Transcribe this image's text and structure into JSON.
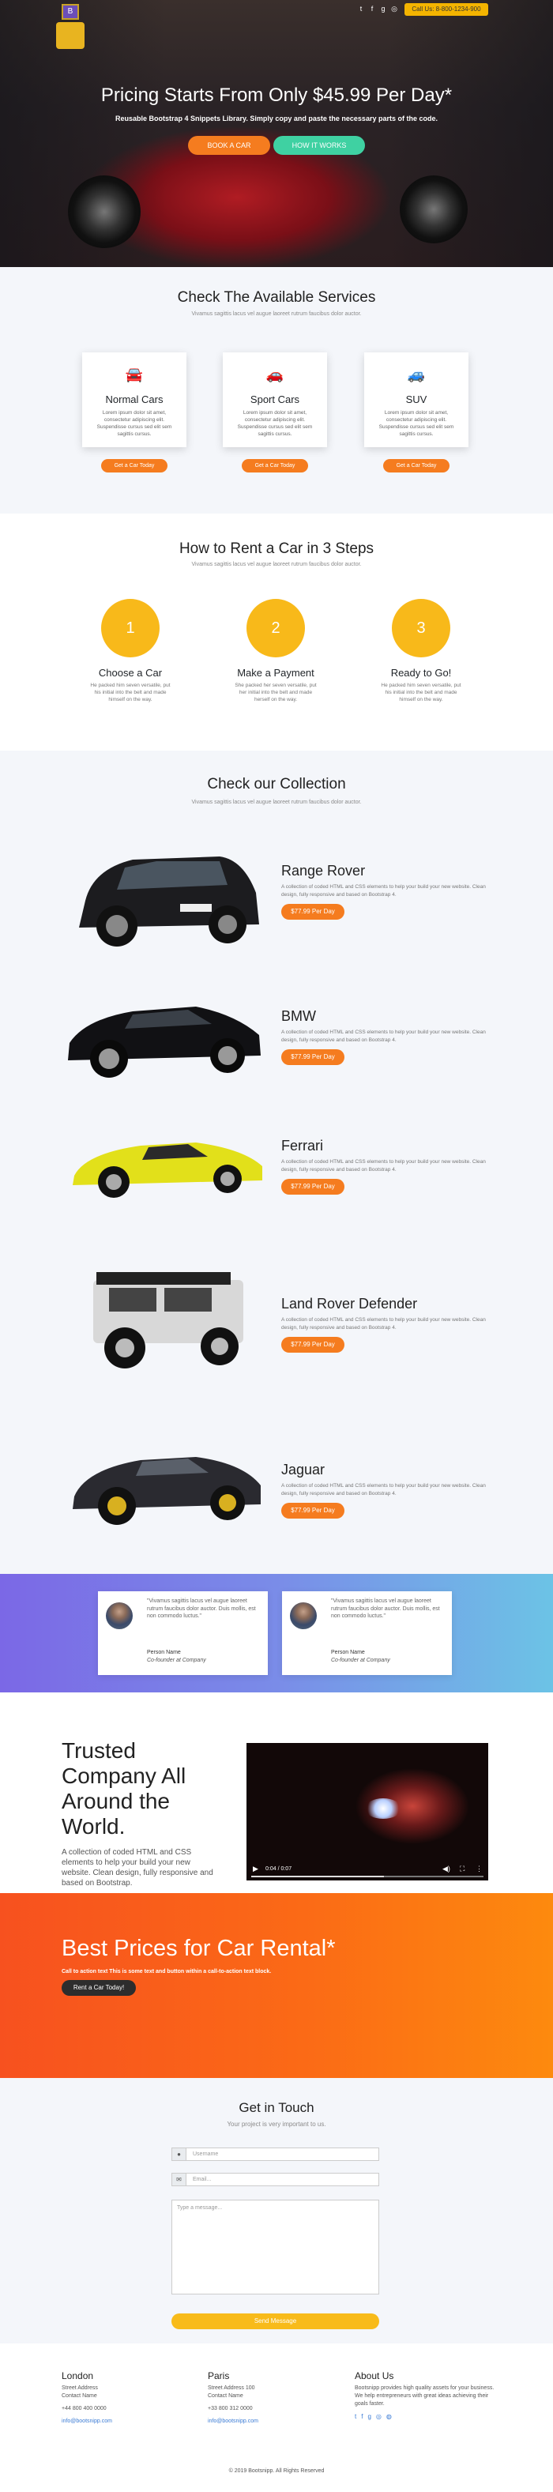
{
  "nav": {
    "logo_label": "B",
    "call_label": "Call Us: 8-800-1234-900",
    "social_icons": [
      "twitter-icon",
      "facebook-icon",
      "google-plus-icon",
      "instagram-icon"
    ]
  },
  "hero": {
    "title": "Pricing Starts From Only $45.99 Per Day*",
    "subtitle": "Reusable Bootstrap 4 Snippets Library. Simply copy and paste the necessary parts of the code.",
    "book_button": "BOOK A CAR",
    "how_button": "HOW IT WORKS"
  },
  "services": {
    "title": "Check The Available Services",
    "subtitle": "Vivamus sagittis lacus vel augue laoreet rutrum faucibus dolor auctor.",
    "cards": [
      {
        "title": "Normal Cars",
        "icon": "car-icon",
        "text": "Lorem ipsum dolor sit amet, consectetur adipiscing elit. Suspendisse cursus sed elit sem sagittis cursus.",
        "button": "Get a Car Today"
      },
      {
        "title": "Sport Cars",
        "icon": "sport-car-icon",
        "text": "Lorem ipsum dolor sit amet, consectetur adipiscing elit. Suspendisse cursus sed elit sem sagittis cursus.",
        "button": "Get a Car Today"
      },
      {
        "title": "SUV",
        "icon": "suv-icon",
        "text": "Lorem ipsum dolor sit amet, consectetur adipiscing elit. Suspendisse cursus sed elit sem sagittis cursus.",
        "button": "Get a Car Today"
      }
    ]
  },
  "steps": {
    "title": "How to Rent a Car in 3 Steps",
    "subtitle": "Vivamus sagittis lacus vel augue laoreet rutrum faucibus dolor auctor.",
    "items": [
      {
        "number": "1",
        "title": "Choose a Car",
        "text": "He packed him seven versatile, put his initial into the belt and made himself on the way."
      },
      {
        "number": "2",
        "title": "Make a Payment",
        "text": "She packed her seven versatile, put her initial into the belt and made herself on the way."
      },
      {
        "number": "3",
        "title": "Ready to Go!",
        "text": "He packed him seven versatile, put his initial into the belt and made himself on the way."
      }
    ]
  },
  "collection": {
    "title": "Check our Collection",
    "subtitle": "Vivamus sagittis lacus vel augue laoreet rutrum faucibus dolor auctor.",
    "cars": [
      {
        "name": "Range Rover",
        "text": "A collection of coded HTML and CSS elements to help your build your new website. Clean design, fully responsive and based on Bootstrap 4.",
        "price": "$77.99 Per Day",
        "color": "#1c1c1f"
      },
      {
        "name": "BMW",
        "text": "A collection of coded HTML and CSS elements to help your build your new website. Clean design, fully responsive and based on Bootstrap 4.",
        "price": "$77.99 Per Day",
        "color": "#111114"
      },
      {
        "name": "Ferrari",
        "text": "A collection of coded HTML and CSS elements to help your build your new website. Clean design, fully responsive and based on Bootstrap 4.",
        "price": "$77.99 Per Day",
        "color": "#e2e01a"
      },
      {
        "name": "Land Rover Defender",
        "text": "A collection of coded HTML and CSS elements to help your build your new website. Clean design, fully responsive and based on Bootstrap 4.",
        "price": "$77.99 Per Day",
        "color": "#d8d8d8"
      },
      {
        "name": "Jaguar",
        "text": "A collection of coded HTML and CSS elements to help your build your new website. Clean design, fully responsive and based on Bootstrap 4.",
        "price": "$77.99 Per Day",
        "color": "#2a2a30"
      }
    ]
  },
  "testimonials": [
    {
      "quote": "\"Vivamus sagittis lacus vel augue laoreet rutrum faucibus dolor auctor. Duis mollis, est non commodo luctus.\"",
      "name": "Person Name",
      "role": "Co-founder at Company"
    },
    {
      "quote": "\"Vivamus sagittis lacus vel augue laoreet rutrum faucibus dolor auctor. Duis mollis, est non commodo luctus.\"",
      "name": "Person Name",
      "role": "Co-founder at Company"
    }
  ],
  "trusted": {
    "title": "Trusted Company All Around the World.",
    "text": "A collection of coded HTML and CSS elements to help your build your new website. Clean design, fully responsive and based on Bootstrap.",
    "video_time": "0:04 / 0:07"
  },
  "cta": {
    "title": "Best Prices for Car Rental*",
    "text": "Call to action text This is some text and button within a call-to-action text block.",
    "button": "Rent a Car Today!"
  },
  "contact": {
    "title": "Get in Touch",
    "subtitle": "Your project is very important to us.",
    "username_placeholder": "Username",
    "email_placeholder": "Email...",
    "message_placeholder": "Type a message...",
    "send_button": "Send Message"
  },
  "footer": {
    "london": {
      "title": "London",
      "lines": [
        "Street Address",
        "Contact Name",
        "+44 800 400 0000",
        "info@bootsnipp.com"
      ]
    },
    "paris": {
      "title": "Paris",
      "lines": [
        "Street Address 100",
        "Contact Name",
        "+33 800 312 0000",
        "info@bootsnipp.com"
      ]
    },
    "about": {
      "title": "About Us",
      "text": "Bootsnipp provides high quality assets for your business. We help entrepreneurs with great ideas achieving their goals faster."
    },
    "copyright": "© 2019 Bootsnipp. All Rights Reserved"
  }
}
